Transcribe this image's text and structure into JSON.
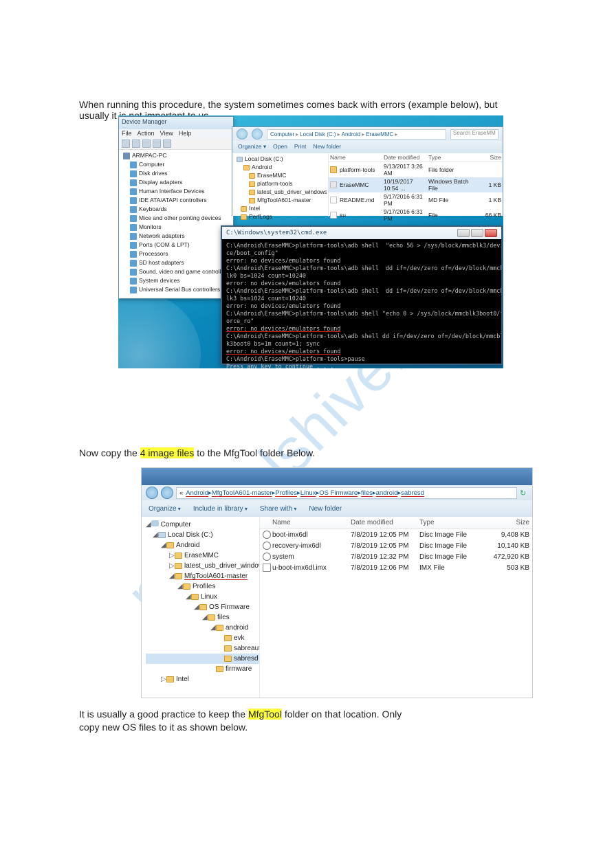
{
  "doc": {
    "para1a": "When running this procedure, the system sometimes comes back with errors (example",
    "para1b": "below), but usually it is not important to us.",
    "para2a": "Now copy the ",
    "para2b": "4 image files",
    "para2c": " to the MfgTool folder Below.",
    "para3a": "It is usually a good practice to keep the ",
    "para3b": "MfgTool",
    "para3c": " folder on that location. Only",
    "para3d": "copy new OS files to it as shown below."
  },
  "devmgr": {
    "title": "Device Manager",
    "menu": {
      "file": "File",
      "action": "Action",
      "view": "View",
      "help": "Help"
    },
    "root": "ARMPAC-PC",
    "nodes": [
      "Computer",
      "Disk drives",
      "Display adapters",
      "Human Interface Devices",
      "IDE ATA/ATAPI controllers",
      "Keyboards",
      "Mice and other pointing devices",
      "Monitors",
      "Network adapters",
      "Ports (COM & LPT)",
      "Processors",
      "SD host adapters",
      "Sound, video and game controllers",
      "System devices",
      "Universal Serial Bus controllers"
    ]
  },
  "explorer1": {
    "breadcrumb": [
      "Computer",
      "Local Disk (C:)",
      "Android",
      "EraseMMC"
    ],
    "search_hint": "Search EraseMM",
    "tb": {
      "organize": "Organize ▾",
      "open": "Open",
      "print": "Print",
      "newfolder": "New folder"
    },
    "side": {
      "root": "Local Disk (C:)",
      "items": [
        "Android",
        "EraseMMC",
        "platform-tools",
        "latest_usb_driver_windows",
        "MfgToolA601-master",
        "Intel",
        "PerfLogs"
      ]
    },
    "hdr": {
      "name": "Name",
      "date": "Date modified",
      "type": "Type",
      "size": "Size"
    },
    "rows": [
      {
        "name": "platform-tools",
        "date": "9/13/2017 3:26 AM",
        "type": "File folder",
        "size": "",
        "kind": "folder"
      },
      {
        "name": "EraseMMC",
        "date": "10/19/2017 10:54 …",
        "type": "Windows Batch File",
        "size": "1 KB",
        "kind": "bat",
        "sel": true
      },
      {
        "name": "README.md",
        "date": "9/17/2016 6:31 PM",
        "type": "MD File",
        "size": "1 KB",
        "kind": "file"
      },
      {
        "name": "su",
        "date": "9/17/2016 6:31 PM",
        "type": "File",
        "size": "66 KB",
        "kind": "file"
      }
    ]
  },
  "cmd": {
    "title": "C:\\Windows\\system32\\cmd.exe",
    "lines": [
      {
        "t": "C:\\Android\\EraseMMC>platform-tools\\adb shell  \"echo 56 > /sys/block/mmcblk3/devi",
        "c": ""
      },
      {
        "t": "ce/boot_config\"",
        "c": ""
      },
      {
        "t": "error: no devices/emulators found",
        "c": ""
      },
      {
        "t": "",
        "c": ""
      },
      {
        "t": "C:\\Android\\EraseMMC>platform-tools\\adb shell  dd if=/dev/zero of=/dev/block/mmcb",
        "c": ""
      },
      {
        "t": "lk0 bs=1024 count=10240",
        "c": ""
      },
      {
        "t": "error: no devices/emulators found",
        "c": ""
      },
      {
        "t": "",
        "c": ""
      },
      {
        "t": "C:\\Android\\EraseMMC>platform-tools\\adb shell  dd if=/dev/zero of=/dev/block/mmcb",
        "c": ""
      },
      {
        "t": "lk3 bs=1024 count=10240",
        "c": ""
      },
      {
        "t": "error: no devices/emulators found",
        "c": ""
      },
      {
        "t": "",
        "c": ""
      },
      {
        "t": "C:\\Android\\EraseMMC>platform-tools\\adb shell \"echo 0 > /sys/block/mmcblk3boot0/f",
        "c": ""
      },
      {
        "t": "orce_ro\"",
        "c": ""
      },
      {
        "t": "error: no devices/emulators found",
        "c": "err"
      },
      {
        "t": "",
        "c": ""
      },
      {
        "t": "C:\\Android\\EraseMMC>platform-tools\\adb shell dd if=/dev/zero of=/dev/block/mmcbl",
        "c": ""
      },
      {
        "t": "k3boot0 bs=1m count=1; sync",
        "c": ""
      },
      {
        "t": "error: no devices/emulators found",
        "c": "err"
      },
      {
        "t": "",
        "c": ""
      },
      {
        "t": "C:\\Android\\EraseMMC>platform-tools>pause",
        "c": ""
      },
      {
        "t": "Press any key to continue . . .",
        "c": ""
      }
    ]
  },
  "explorer2": {
    "breadcrumb": [
      "Android",
      "MfgToolA601-master",
      "Profiles",
      "Linux",
      "OS Firmware",
      "files",
      "android",
      "sabresd"
    ],
    "tb": {
      "organize": "Organize",
      "include": "Include in library",
      "share": "Share with",
      "newfolder": "New folder"
    },
    "side": {
      "computer": "Computer",
      "disk": "Local Disk (C:)",
      "android": "Android",
      "erase": "EraseMMC",
      "latest": "latest_usb_driver_windows",
      "mfg": "MfgToolA601-master",
      "profiles": "Profiles",
      "linux": "Linux",
      "osfw": "OS Firmware",
      "files": "files",
      "android2": "android",
      "evk": "evk",
      "sabreauto": "sabreauto",
      "sabresd": "sabresd",
      "firmware": "firmware",
      "intel": "Intel"
    },
    "hdr": {
      "name": "Name",
      "date": "Date modified",
      "type": "Type",
      "size": "Size"
    },
    "rows": [
      {
        "name": "boot-imx6dl",
        "date": "7/8/2019 12:05 PM",
        "type": "Disc Image File",
        "size": "9,408 KB",
        "kind": "disc"
      },
      {
        "name": "recovery-imx6dl",
        "date": "7/8/2019 12:05 PM",
        "type": "Disc Image File",
        "size": "10,140 KB",
        "kind": "disc"
      },
      {
        "name": "system",
        "date": "7/8/2019 12:32 PM",
        "type": "Disc Image File",
        "size": "472,920 KB",
        "kind": "disc"
      },
      {
        "name": "u-boot-imx6dl.imx",
        "date": "7/8/2019 12:06 PM",
        "type": "IMX File",
        "size": "503 KB",
        "kind": "file"
      }
    ]
  },
  "wm": "manualshive.com"
}
